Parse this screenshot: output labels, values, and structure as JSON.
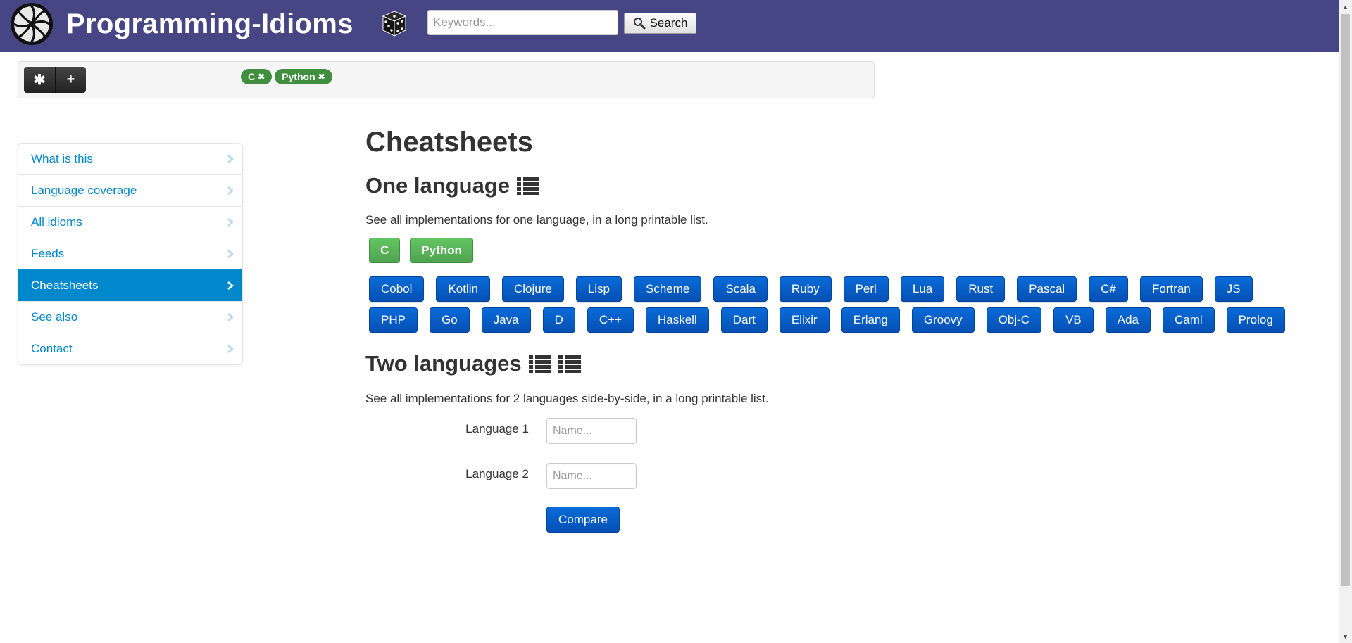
{
  "header": {
    "brand": "Programming-Idioms",
    "search_placeholder": "Keywords...",
    "search_label": "Search"
  },
  "favorites_bar": {
    "star_label": "✱",
    "plus_label": "+",
    "tags": [
      "C",
      "Python"
    ],
    "tag_color": "#3f8f3f"
  },
  "sidebar": {
    "items": [
      {
        "label": "What is this",
        "active": false
      },
      {
        "label": "Language coverage",
        "active": false
      },
      {
        "label": "All idioms",
        "active": false
      },
      {
        "label": "Feeds",
        "active": false
      },
      {
        "label": "Cheatsheets",
        "active": true
      },
      {
        "label": "See also",
        "active": false
      },
      {
        "label": "Contact",
        "active": false
      }
    ],
    "active_color": "#0088cc"
  },
  "main": {
    "title": "Cheatsheets",
    "one_language": {
      "heading": "One language",
      "description": "See all implementations for one language, in a long printable list.",
      "favorite_buttons": [
        "C",
        "Python"
      ],
      "languages_row1": [
        "Cobol",
        "Kotlin",
        "Clojure",
        "Lisp",
        "Scheme",
        "Scala",
        "Ruby",
        "Perl",
        "Lua",
        "Rust",
        "Pascal",
        "C#",
        "Fortran",
        "JS"
      ],
      "languages_row2": [
        "PHP",
        "Go",
        "Java",
        "D",
        "C++",
        "Haskell",
        "Dart",
        "Elixir",
        "Erlang",
        "Groovy",
        "Obj-C",
        "VB",
        "Ada",
        "Caml",
        "Prolog"
      ]
    },
    "two_languages": {
      "heading": "Two languages",
      "description": "See all implementations for 2 languages side-by-side, in a long printable list.",
      "language1_label": "Language 1",
      "language2_label": "Language 2",
      "name_placeholder": "Name...",
      "compare_label": "Compare"
    }
  },
  "colors": {
    "header_bg": "#464685",
    "button_blue": "#0450b4",
    "button_green": "#51a351"
  }
}
